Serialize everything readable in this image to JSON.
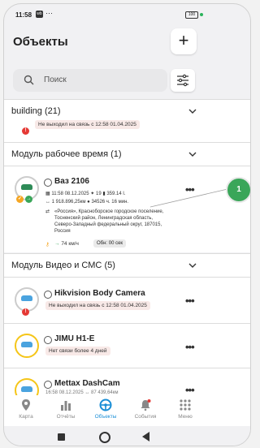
{
  "status_bar": {
    "time": "11:58",
    "app_badge": "wb",
    "dots": "···",
    "signal": "⁴⁶",
    "battery": "100"
  },
  "header": {
    "title": "Объекты",
    "add_label": "+"
  },
  "search": {
    "placeholder": "Поиск"
  },
  "groups": [
    {
      "label": "building",
      "count": "(21)"
    },
    {
      "label": "Модуль  рабочее время",
      "count": "(1)"
    },
    {
      "label": "Модуль Видео и СМС",
      "count": "(5)"
    }
  ],
  "partial_card": {
    "tag": "Не выходил на связь с 12:58 01.04.2025"
  },
  "vaz": {
    "name": "Ваз 2106",
    "datetime": "11:58 08.12.2025",
    "satellites": "19",
    "fuel": "359.14 l.",
    "odometer": "1 918.896,25км",
    "engine_hours": "34526 ч. 16 мин.",
    "address": "«Россия», Красноборское городское поселение, Тосненский район, Ленинградская область, Северо-Западный федеральный округ, 187015, Россия",
    "speed": "74 км/ч",
    "rpm": "Обн: 00 сек"
  },
  "objects": [
    {
      "name": "Hikvision Body Camera",
      "tag": "Не выходил на связь с 12:58 01.04.2025"
    },
    {
      "name": "JIMU H1-E",
      "tag": "Нет связи более 4 дней"
    },
    {
      "name": "Mettax DashCam",
      "tag": "16:58 08.12.2025  ↔ 87 439,64км"
    }
  ],
  "callout": {
    "number": "1"
  },
  "tabs": [
    {
      "label": "Карта",
      "icon": "map-pin-icon"
    },
    {
      "label": "Отчёты",
      "icon": "bar-chart-icon"
    },
    {
      "label": "Объекты",
      "icon": "steering-wheel-icon"
    },
    {
      "label": "События",
      "icon": "bell-icon"
    },
    {
      "label": "Меню",
      "icon": "grid-icon"
    }
  ],
  "colors": {
    "accent": "#1a8ed6",
    "callout": "#3aa659",
    "warning": "#e53935",
    "orange": "#f5a623"
  }
}
